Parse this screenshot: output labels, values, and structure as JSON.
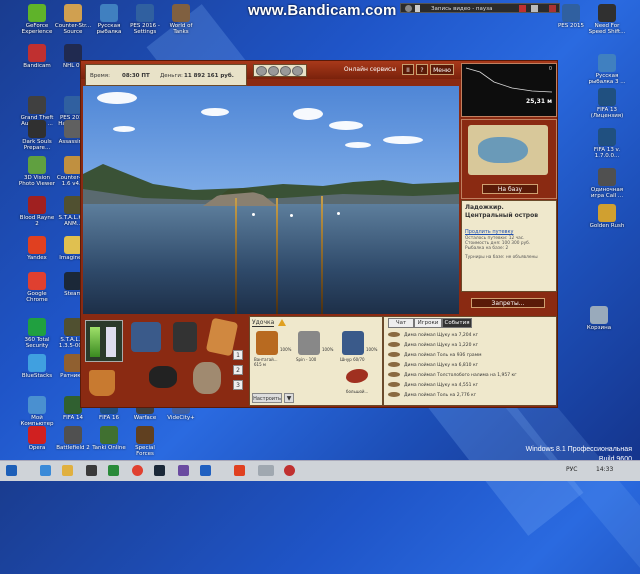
{
  "watermark": "www.Bandicam.com",
  "recorder": {
    "status": "Запись видео - пауза"
  },
  "desktop_icons_left": [
    {
      "label": "GeForce Experience",
      "color": "#5fb32a"
    },
    {
      "label": "Counter-Str... Source",
      "color": "#d0a050"
    },
    {
      "label": "Русская рыбалка",
      "color": "#4080c0"
    },
    {
      "label": "PES 2016 - Settings",
      "color": "#3060a0"
    },
    {
      "label": "World of Tanks",
      "color": "#806040"
    },
    {
      "label": "Bandicam",
      "color": "#c03030"
    },
    {
      "label": "NHL 09",
      "color": "#202a50"
    },
    {
      "label": "Grand Theft Auto San ...",
      "color": "#404040"
    },
    {
      "label": "PES 2016 Настрой...",
      "color": "#3060a0"
    },
    {
      "label": "Dark Souls Prepare...",
      "color": "#303030"
    },
    {
      "label": "Assassin...",
      "color": "#606060"
    },
    {
      "label": "3D Vision Photo Viewer",
      "color": "#60a040"
    },
    {
      "label": "Counter-S... 1.6 v4...",
      "color": "#c09040"
    },
    {
      "label": "Blood Rayne 2",
      "color": "#a02020"
    },
    {
      "label": "S.T.A.L.K. - ANM...",
      "color": "#505030"
    },
    {
      "label": "Yandex",
      "color": "#e04020"
    },
    {
      "label": "Imagine...",
      "color": "#e0c050"
    },
    {
      "label": "Google Chrome",
      "color": "#e04030"
    },
    {
      "label": "Steam",
      "color": "#1b2838"
    },
    {
      "label": "360 Total Security",
      "color": "#20a040"
    },
    {
      "label": "S.T.A.L.K. 1.3.5-00...",
      "color": "#505030"
    },
    {
      "label": "BlueStacks",
      "color": "#40a0e0"
    },
    {
      "label": "Ратник...",
      "color": "#906030"
    },
    {
      "label": "Мой Компьютер",
      "color": "#4a90d0"
    },
    {
      "label": "FIFA 14",
      "color": "#306030"
    },
    {
      "label": "FIFA 16",
      "color": "#205080"
    },
    {
      "label": "Warface",
      "color": "#404040"
    },
    {
      "label": "VideCity+",
      "color": "#4060a0"
    },
    {
      "label": "Opera",
      "color": "#d02020"
    },
    {
      "label": "Battlefield 2",
      "color": "#505050"
    },
    {
      "label": "Tanki Online",
      "color": "#407030"
    },
    {
      "label": "Special Forces",
      "color": "#604020"
    }
  ],
  "desktop_icons_right": [
    {
      "label": "PES 2015",
      "color": "#3060a0"
    },
    {
      "label": "Need For Speed Shift...",
      "color": "#303030"
    },
    {
      "label": "Русская рыбалка 3 ...",
      "color": "#4080c0"
    },
    {
      "label": "FIFA 13 (Лицензия)",
      "color": "#205080"
    },
    {
      "label": "FIFA 13 v. 1.7.0.0...",
      "color": "#205080"
    },
    {
      "label": "Одиночная игра Call ...",
      "color": "#505050"
    },
    {
      "label": "Golden Rush",
      "color": "#d0a030"
    },
    {
      "label": "Корзина",
      "color": "#9ab"
    }
  ],
  "game": {
    "time_label": "Время:",
    "time_value": "08:30 ПТ",
    "money_label": "Деньги:",
    "money_value": "11 892 161 руб.",
    "online_button": "Онлайн сервисы",
    "pause_button": "II",
    "help_button": "?",
    "menu_button": "Меню",
    "depth_value": "25,31 м",
    "depth_top_label": "0",
    "to_base_button": "На базу",
    "location_region": "Ладожкир.",
    "location_name": "Центральный остров",
    "extend_trip_link": "Продлить путевку",
    "trip_info": [
      "Осталось путевки: 12 час.",
      "Стоимость дня: 100 300 руб.",
      "Рыбалка на базе: 2"
    ],
    "tournaments_info": "Турниры на базе: не объявлены",
    "bans_button": "Запреты...",
    "tackle_tab": "Удочка",
    "tackle_items": [
      {
        "caption": "Вантагай...\n615 м",
        "percent": "100%"
      },
      {
        "caption": "Spin - 100",
        "percent": "100%"
      },
      {
        "caption": "Шнур 60/70",
        "percent": "100%"
      }
    ],
    "rig_caption": "большой...",
    "setup_button": "Настроить",
    "rod_slots": [
      "1",
      "2",
      "3"
    ],
    "chat_tabs": [
      "Чат",
      "Игроки",
      "События"
    ],
    "events": [
      "Дима поймал Щуку на 7,204 кг",
      "Дима поймал Щуку на 1,220 кг",
      "Дима поймал Толь на 936 грамм",
      "Дима поймал Щуку на 6,810 кг",
      "Дима поймал Толстолобого налима на 1,957 кг",
      "Дима поймал Щуку на 4,551 кг",
      "Дима поймал Толь на 2,776 кг"
    ]
  },
  "os": {
    "edition": "Windows 8.1 Профессиональная",
    "build": "Build 9600",
    "language": "РУС",
    "clock": "14:33"
  }
}
